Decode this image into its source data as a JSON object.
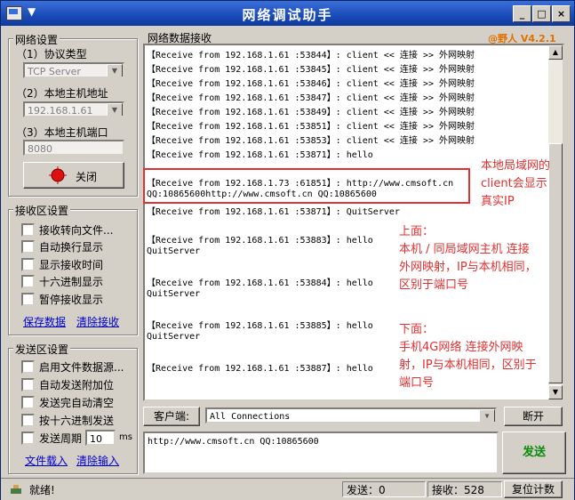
{
  "window": {
    "title": "网络调试助手",
    "min_label": "_",
    "max_label": "□",
    "close_label": "×"
  },
  "net_settings": {
    "group_label": "网络设置",
    "protocol_label": "（1）协议类型",
    "protocol_value": "TCP Server",
    "host_ip_label": "（2）本地主机地址",
    "host_ip_value": "192.168.1.61",
    "port_label": "（3）本地主机端口",
    "port_value": "8080",
    "close_button": "关闭"
  },
  "recv_settings": {
    "group_label": "接收区设置",
    "options": [
      "接收转向文件...",
      "自动换行显示",
      "显示接收时间",
      "十六进制显示",
      "暂停接收显示"
    ],
    "save_link": "保存数据",
    "clear_link": "清除接收"
  },
  "send_settings": {
    "group_label": "发送区设置",
    "options": [
      "启用文件数据源...",
      "自动发送附加位",
      "发送完自动清空",
      "按十六进制发送"
    ],
    "period_label": "发送周期",
    "period_value": "10",
    "period_unit": "ms",
    "load_link": "文件载入",
    "clear_link": "清除输入"
  },
  "receive_area": {
    "label": "网络数据接收",
    "version": "@野人 V4.2.1",
    "lines": [
      "【Receive from 192.168.1.61 :53844】: client << 连接 >> 外网映射",
      "【Receive from 192.168.1.61 :53845】: client << 连接 >> 外网映射",
      "【Receive from 192.168.1.61 :53846】: client << 连接 >> 外网映射",
      "【Receive from 192.168.1.61 :53847】: client << 连接 >> 外网映射",
      "【Receive from 192.168.1.61 :53849】: client << 连接 >> 外网映射",
      "【Receive from 192.168.1.61 :53851】: client << 连接 >> 外网映射",
      "【Receive from 192.168.1.61 :53853】: client << 连接 >> 外网映射",
      "【Receive from 192.168.1.61 :53871】: hello",
      "",
      "【Receive from 192.168.1.73 :61851】: http://www.cmsoft.cn",
      "QQ:10865600http://www.cmsoft.cn QQ:10865600",
      "【Receive from 192.168.1.61 :53871】: QuitServer",
      "",
      "【Receive from 192.168.1.61 :53883】: hello",
      "QuitServer",
      "",
      "【Receive from 192.168.1.61 :53884】: hello",
      "QuitServer",
      "",
      "【Receive from 192.168.1.61 :53885】: hello",
      "QuitServer",
      "",
      "【Receive from 192.168.1.61 :53887】: hello"
    ]
  },
  "annotations": {
    "note1": [
      "本地局域网的",
      "client会显示",
      "真实IP"
    ],
    "note2": [
      "上面：",
      "本机 / 同局域网主机 连接",
      "外网映射，IP与本机相同，",
      "区别于端口号"
    ],
    "note3": [
      "下面：",
      "手机4G网络 连接外网映",
      "射，IP与本机相同，区别于",
      "端口号"
    ],
    "color": "#e03030"
  },
  "client_bar": {
    "label": "客户端:",
    "selected": "All Connections",
    "disconnect_button": "断开"
  },
  "send_area": {
    "input_value": "http://www.cmsoft.cn QQ:10865600",
    "send_button": "发送"
  },
  "status_bar": {
    "ready_text": "就绪!",
    "send_count": "发送：0",
    "recv_count": "接收：528",
    "reset_button": "复位计数"
  }
}
